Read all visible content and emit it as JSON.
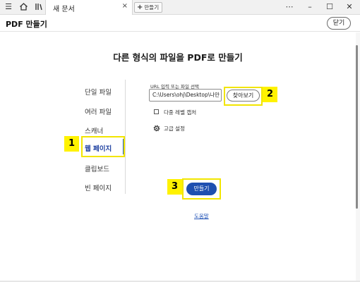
{
  "titlebar": {
    "menu_icon": "hamburger-menu-icon",
    "home_icon": "home-icon",
    "library_icon": "library-icon",
    "tab_label": "새 문서",
    "tab_close": "×",
    "new_tab_label": "만들기",
    "more_icon": "more-icon",
    "minimize": "–",
    "maximize": "☐",
    "close": "✕"
  },
  "header": {
    "title": "PDF 만들기",
    "close_button": "닫기"
  },
  "main": {
    "title": "다른 형식의 파일을 PDF로 만들기"
  },
  "sidebar": {
    "items": [
      {
        "label": "단일 파일"
      },
      {
        "label": "여러 파일"
      },
      {
        "label": "스캐너"
      },
      {
        "label": "웹 페이지",
        "active": true
      },
      {
        "label": "클립보드"
      },
      {
        "label": "빈 페이지"
      }
    ]
  },
  "web_page": {
    "url_label": "URL 입력 또는 파일 선택",
    "url_value": "C:\\Users\\ohj\\Desktop\\나만",
    "browse_button": "찾아보기",
    "multi_level_label": "다중 레벨 캡처",
    "multi_level_checked": false,
    "advanced_label": "고급 설정",
    "create_button": "만들기",
    "help_link": "도움말"
  },
  "annotations": {
    "badge_1": "1",
    "badge_2": "2",
    "badge_3": "3"
  },
  "colors": {
    "accent": "#1e4fb0",
    "highlight": "#fff200",
    "active_nav": "#1d3fa0"
  }
}
